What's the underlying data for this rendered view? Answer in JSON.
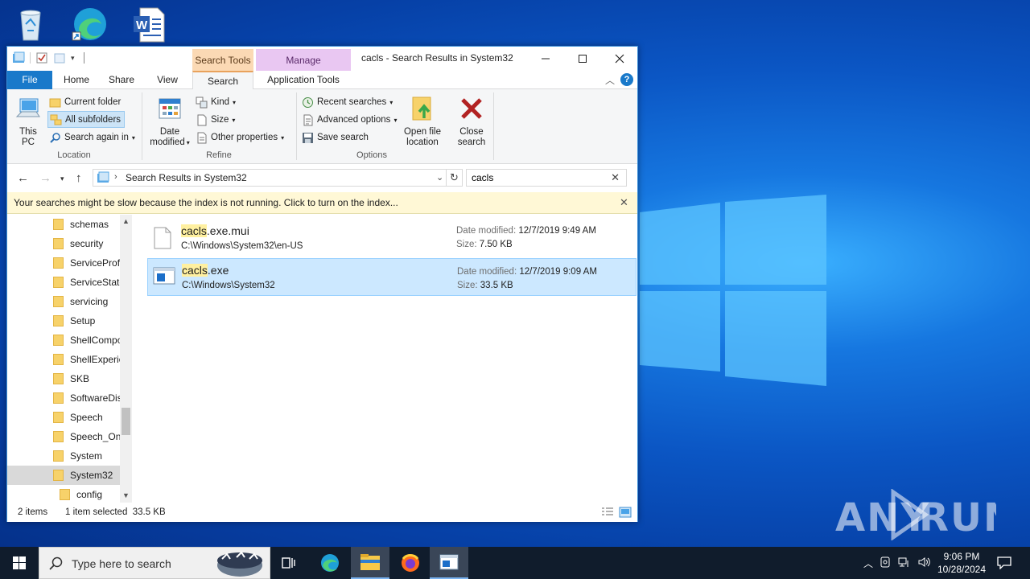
{
  "window": {
    "title": "cacls - Search Results in System32",
    "ctx_search_tools": "Search Tools",
    "ctx_manage": "Manage"
  },
  "tabs": [
    {
      "label": "File"
    },
    {
      "label": "Home"
    },
    {
      "label": "Share"
    },
    {
      "label": "View"
    },
    {
      "label": "Search"
    },
    {
      "label": "Application Tools"
    }
  ],
  "ribbon": {
    "location": {
      "this_pc_1": "This",
      "this_pc_2": "PC",
      "current_folder": "Current folder",
      "all_subfolders": "All subfolders",
      "search_again": "Search again in",
      "label": "Location"
    },
    "refine": {
      "date_modified_1": "Date",
      "date_modified_2": "modified",
      "kind": "Kind",
      "size": "Size",
      "other_properties": "Other properties",
      "label": "Refine"
    },
    "options": {
      "recent_searches": "Recent searches",
      "advanced_options": "Advanced options",
      "save_search": "Save search",
      "open_file_location_1": "Open file",
      "open_file_location_2": "location",
      "close_search_1": "Close",
      "close_search_2": "search",
      "label": "Options"
    }
  },
  "address": {
    "path": "Search Results in System32",
    "search_value": "cacls"
  },
  "infobar": {
    "message": "Your searches might be slow because the index is not running.  Click to turn on the index..."
  },
  "nav": {
    "items": [
      {
        "label": "schemas"
      },
      {
        "label": "security"
      },
      {
        "label": "ServiceProfi"
      },
      {
        "label": "ServiceState"
      },
      {
        "label": "servicing"
      },
      {
        "label": "Setup"
      },
      {
        "label": "ShellCompo"
      },
      {
        "label": "ShellExperie"
      },
      {
        "label": "SKB"
      },
      {
        "label": "SoftwareDis"
      },
      {
        "label": "Speech"
      },
      {
        "label": "Speech_One"
      },
      {
        "label": "System"
      },
      {
        "label": "System32"
      },
      {
        "label": "config"
      }
    ]
  },
  "results": [
    {
      "name_hl": "cacls",
      "name_rest": ".exe.mui",
      "path": "C:\\Windows\\System32\\en-US",
      "date_label": "Date modified:",
      "date": "12/7/2019 9:49 AM",
      "size_label": "Size:",
      "size": "7.50 KB"
    },
    {
      "name_hl": "cacls",
      "name_rest": ".exe",
      "path": "C:\\Windows\\System32",
      "date_label": "Date modified:",
      "date": "12/7/2019 9:09 AM",
      "size_label": "Size:",
      "size": "33.5 KB"
    }
  ],
  "status": {
    "count": "2 items",
    "selection": "1 item selected  33.5 KB"
  },
  "taskbar": {
    "search_placeholder": "Type here to search",
    "time": "9:06 PM",
    "date": "10/28/2024"
  },
  "watermark": "ANY RUN",
  "colors": {
    "accent": "#1979ca",
    "selection": "#cce8ff",
    "infobar": "#fff8d6",
    "taskbar": "#101c2c"
  }
}
